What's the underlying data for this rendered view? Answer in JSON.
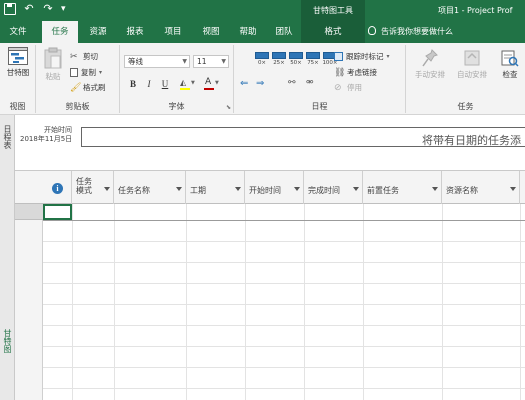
{
  "titlebar": {
    "context_tab_label": "甘特图工具",
    "document_title": "项目1 - Project Prof",
    "qat_icons": [
      "save-icon",
      "undo-icon",
      "redo-icon",
      "customize-qat-icon"
    ]
  },
  "tabs": [
    {
      "label": "文件",
      "active": false
    },
    {
      "label": "任务",
      "active": true
    },
    {
      "label": "资源",
      "active": false
    },
    {
      "label": "报表",
      "active": false
    },
    {
      "label": "项目",
      "active": false
    },
    {
      "label": "视图",
      "active": false
    },
    {
      "label": "帮助",
      "active": false
    },
    {
      "label": "团队",
      "active": false
    },
    {
      "label": "格式",
      "active": false
    }
  ],
  "tell_me": "告诉我你想要做什么",
  "ribbon": {
    "view_group": {
      "label": "视图",
      "gantt_button": "甘特图"
    },
    "clipboard_group": {
      "label": "剪贴板",
      "paste": "粘贴",
      "cut": "剪切",
      "copy": "复制",
      "format_painter": "格式刷"
    },
    "font_group": {
      "label": "字体",
      "font_name": "等线",
      "font_size": "11",
      "bold": "B",
      "italic": "I",
      "underline": "U",
      "font_color_letter": "A"
    },
    "schedule_group": {
      "label": "日程",
      "percent_buttons": [
        "0×",
        "25×",
        "50×",
        "75×",
        "100×"
      ],
      "mark_on_track": "跟踪时标记",
      "respect_links": "考虑链接",
      "inactivate": "停用"
    },
    "tasks_group": {
      "label": "任务",
      "manual_schedule": "手动安排",
      "auto_schedule": "自动安排",
      "inspect": "检查"
    }
  },
  "timeline": {
    "side_label": "日程表",
    "start_label": "开始时间",
    "start_date": "2018年11月5日",
    "hint": "将带有日期的任务添"
  },
  "grid": {
    "side_label": "甘特图",
    "columns": [
      {
        "label": "任务模式"
      },
      {
        "label": "任务名称"
      },
      {
        "label": "工期"
      },
      {
        "label": "开始时间"
      },
      {
        "label": "完成时间"
      },
      {
        "label": "前置任务"
      },
      {
        "label": "资源名称"
      }
    ]
  },
  "colors": {
    "brand_green": "#217346",
    "context_green": "#1a5e39",
    "ribbon_bg": "#f3f3f3",
    "info_blue": "#2e75b6"
  }
}
